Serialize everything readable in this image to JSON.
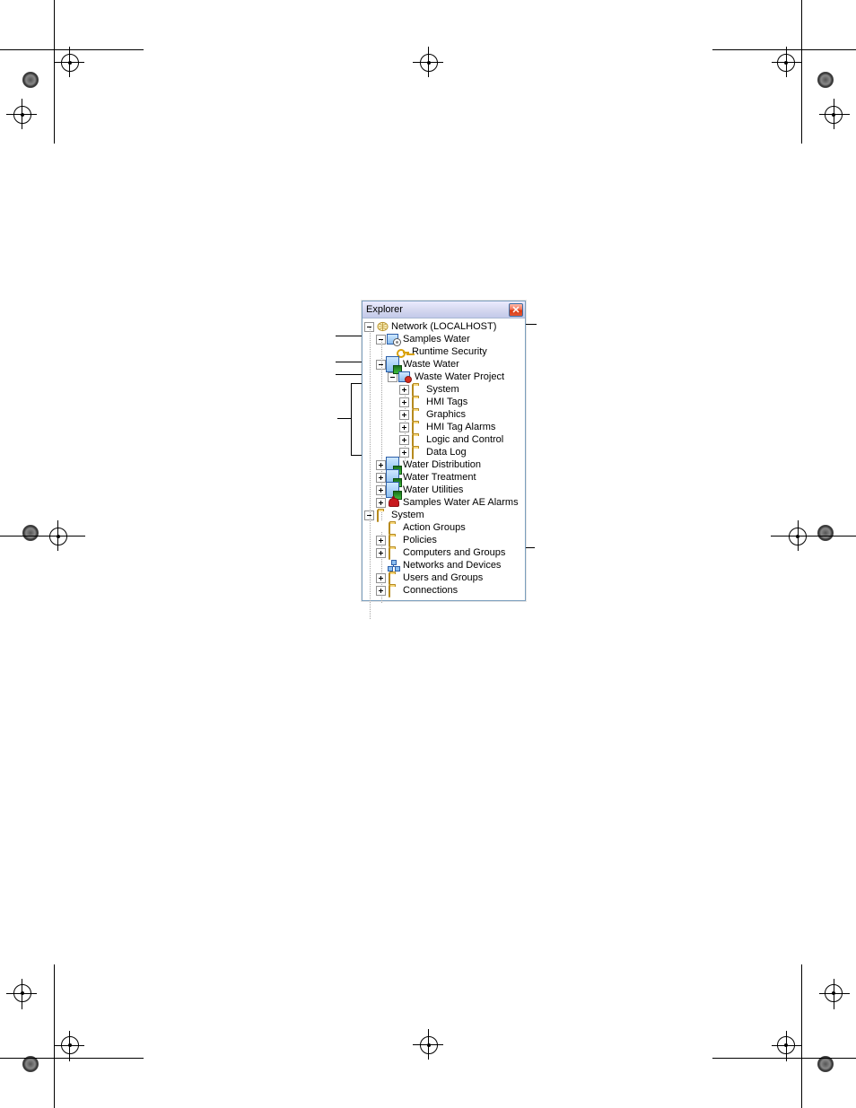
{
  "panel": {
    "title": "Explorer"
  },
  "tree": {
    "root": {
      "label": "Network (LOCALHOST)"
    },
    "samples_water": {
      "label": "Samples Water"
    },
    "runtime_security": {
      "label": "Runtime Security"
    },
    "waste_water": {
      "label": "Waste Water"
    },
    "waste_water_project": {
      "label": "Waste Water Project"
    },
    "wwp": {
      "system": {
        "label": "System"
      },
      "hmi_tags": {
        "label": "HMI Tags"
      },
      "graphics": {
        "label": "Graphics"
      },
      "hmi_tag_alarms": {
        "label": "HMI Tag Alarms"
      },
      "logic_and_control": {
        "label": "Logic and Control"
      },
      "data_log": {
        "label": "Data Log"
      }
    },
    "water_distribution": {
      "label": "Water Distribution"
    },
    "water_treatment": {
      "label": "Water Treatment"
    },
    "water_utilities": {
      "label": "Water Utilities"
    },
    "samples_water_ae_alarms": {
      "label": "Samples Water AE Alarms"
    },
    "system_root": {
      "label": "System"
    },
    "system": {
      "action_groups": {
        "label": "Action Groups"
      },
      "policies": {
        "label": "Policies"
      },
      "computers_and_groups": {
        "label": "Computers and Groups"
      },
      "networks_and_devices": {
        "label": "Networks and Devices"
      },
      "users_and_groups": {
        "label": "Users and Groups"
      },
      "connections": {
        "label": "Connections"
      }
    }
  }
}
